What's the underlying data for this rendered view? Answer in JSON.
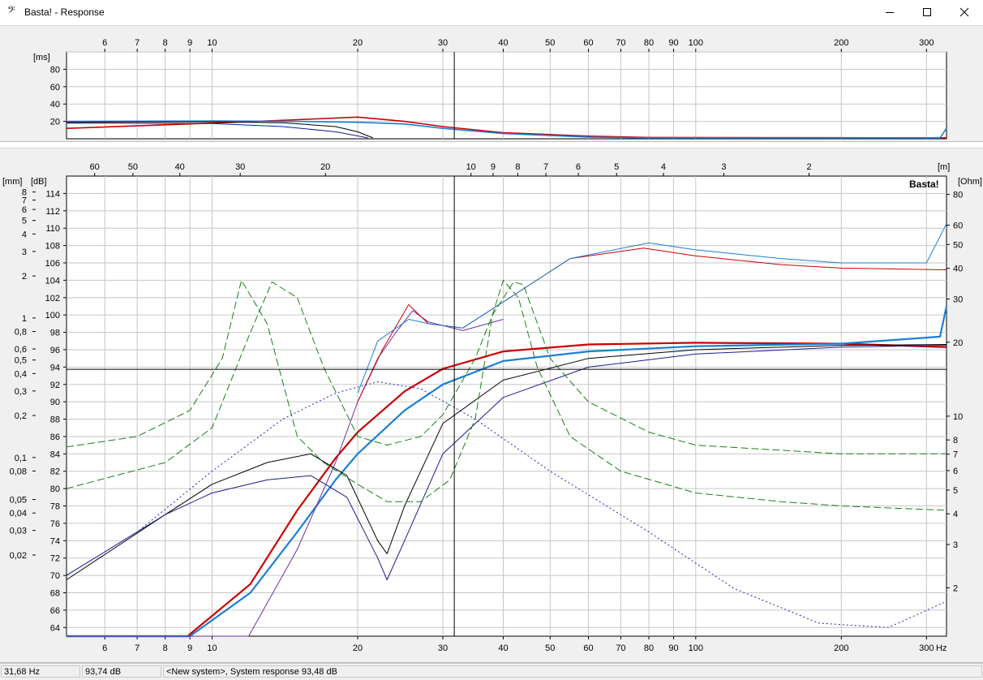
{
  "window": {
    "title": "Basta! - Response",
    "icon": "bass-clef-icon",
    "controls": [
      "minimize-icon",
      "maximize-icon",
      "close-icon"
    ]
  },
  "freq_ticks": [
    "6",
    "7",
    "8",
    "9",
    "10",
    "20",
    "30",
    "40",
    "50",
    "60",
    "70",
    "80",
    "90",
    "100",
    "200",
    "300"
  ],
  "freq_values": [
    6,
    7,
    8,
    9,
    10,
    20,
    30,
    40,
    50,
    60,
    70,
    80,
    90,
    100,
    200,
    300
  ],
  "freq_unit": "Hz",
  "delay_chart": {
    "unit": "[ms]",
    "y_ticks": [
      "80",
      "60",
      "40",
      "20"
    ],
    "y_values": [
      80,
      60,
      40,
      20
    ]
  },
  "main_chart": {
    "wavelength_unit": "[m]",
    "wavelength_ticks": [
      "60",
      "50",
      "40",
      "30",
      "20",
      "10",
      "9",
      "8",
      "7",
      "6",
      "5",
      "4",
      "3",
      "2"
    ],
    "wavelength_values": [
      60,
      50,
      40,
      30,
      20,
      10,
      9,
      8,
      7,
      6,
      5,
      4,
      3,
      2
    ],
    "db_unit": "[dB]",
    "db_ticks": [
      "114",
      "112",
      "110",
      "108",
      "106",
      "104",
      "102",
      "100",
      "98",
      "96",
      "94",
      "92",
      "90",
      "88",
      "86",
      "84",
      "82",
      "80",
      "78",
      "76",
      "74",
      "72",
      "70",
      "68",
      "66",
      "64"
    ],
    "mm_unit": "[mm]",
    "mm_ticks": [
      "8",
      "7",
      "6",
      "5",
      "4",
      "3",
      "2",
      "1",
      "0,8",
      "0,6",
      "0,5",
      "0,4",
      "0,3",
      "0,2",
      "0,1",
      "0,08",
      "0,05",
      "0,04",
      "0,03",
      "0,02"
    ],
    "mm_values": [
      8,
      7,
      6,
      5,
      4,
      3,
      2,
      1,
      0.8,
      0.6,
      0.5,
      0.4,
      0.3,
      0.2,
      0.1,
      0.08,
      0.05,
      0.04,
      0.03,
      0.02
    ],
    "ohm_unit": "[Ohm]",
    "ohm_ticks": [
      "80",
      "60",
      "50",
      "40",
      "30",
      "20",
      "10",
      "8",
      "7",
      "6",
      "5",
      "4",
      "3",
      "2"
    ],
    "ohm_values": [
      80,
      60,
      50,
      40,
      30,
      20,
      10,
      8,
      7,
      6,
      5,
      4,
      3,
      2
    ],
    "watermark": "Basta!"
  },
  "chart_data": {
    "type": "line",
    "x_scale": "log",
    "x_unit": "Hz",
    "xlim": [
      5,
      330
    ],
    "ylim_db": [
      63,
      116
    ],
    "cursor": {
      "frequency_hz": 31.68,
      "level_db": 93.74
    },
    "series": [
      {
        "color": "#cc0000",
        "x": [
          5,
          8.9,
          12,
          15,
          18,
          20,
          25,
          30,
          40,
          60,
          100,
          200,
          330
        ],
        "y": [
          63,
          63,
          69,
          77.5,
          83.5,
          86.5,
          91.2,
          93.8,
          95.8,
          96.6,
          96.8,
          96.7,
          96.3
        ]
      },
      {
        "color": "#1a7fd4",
        "x": [
          5,
          9,
          12,
          15,
          18,
          20,
          25,
          30,
          40,
          60,
          100,
          200,
          320,
          330
        ],
        "y": [
          63,
          63,
          68,
          75,
          81,
          84,
          89,
          92,
          94.7,
          95.8,
          96.4,
          96.7,
          97.5,
          101
        ]
      },
      {
        "color": "#000000",
        "x": [
          5,
          8,
          10,
          13,
          16,
          19,
          22,
          23,
          25,
          30,
          40,
          60,
          100,
          200,
          330
        ],
        "y": [
          69.5,
          77,
          80.5,
          83,
          84,
          81.5,
          74,
          72.5,
          78,
          87.5,
          92.5,
          95,
          96,
          96.5,
          96.6
        ]
      },
      {
        "color": "#1a1a8c",
        "x": [
          5,
          8,
          10,
          13,
          16,
          19,
          22,
          23,
          25,
          30,
          40,
          60,
          100,
          200,
          330
        ],
        "y": [
          70,
          77,
          79.5,
          81,
          81.5,
          79,
          72,
          69.5,
          74,
          84,
          90.5,
          94,
          95.5,
          96.3,
          96.5
        ]
      },
      {
        "color": "#7030a0",
        "x": [
          5,
          11.9,
          15,
          18,
          20,
          22,
          24,
          26,
          28,
          33,
          40
        ],
        "y": [
          63,
          63,
          73,
          83,
          90,
          95,
          98,
          100.5,
          99.2,
          98.2,
          99.5
        ]
      },
      {
        "color": "#cc0000",
        "x": [
          20,
          22.5,
          25.5,
          28,
          33,
          40,
          55,
          78,
          100,
          150,
          200,
          330
        ],
        "y": [
          90,
          96,
          101.2,
          99,
          98.5,
          101.5,
          106.5,
          107.7,
          106.8,
          105.8,
          105.4,
          105.2
        ]
      },
      {
        "color": "#1a7fd4",
        "x": [
          20,
          22,
          25.5,
          28,
          33,
          40,
          55,
          80,
          100,
          150,
          200,
          300,
          330
        ],
        "y": [
          91,
          97,
          99.5,
          99,
          98.5,
          101.5,
          106.5,
          108.3,
          107.5,
          106.5,
          106,
          106,
          110.5
        ]
      },
      {
        "color": "#1a7f1a",
        "x": [
          5,
          7,
          9,
          10.5,
          11.5,
          13,
          15,
          17,
          20,
          23,
          27,
          31,
          35,
          38,
          40,
          43,
          47,
          55,
          70,
          100,
          150,
          200,
          330
        ],
        "y": [
          84.8,
          86,
          89,
          95,
          104,
          99,
          86,
          83,
          80.5,
          78.5,
          78.5,
          81,
          88,
          100,
          104,
          102,
          94,
          86,
          82,
          79.5,
          78.5,
          78,
          77.5
        ]
      },
      {
        "color": "#1a7f1a",
        "x": [
          5,
          8,
          10,
          12,
          13.3,
          15,
          17,
          20,
          23,
          27,
          30,
          35,
          38,
          42,
          44,
          50,
          60,
          80,
          100,
          200,
          330
        ],
        "y": [
          80,
          83,
          87,
          98,
          103.8,
          102,
          94,
          86,
          85,
          86,
          88.5,
          95,
          100,
          103.8,
          103.5,
          95,
          90,
          86.5,
          85,
          84,
          84
        ]
      },
      {
        "color": "#2424b4",
        "x": [
          5,
          7,
          10,
          14,
          18,
          22,
          27,
          35,
          50,
          80,
          120,
          180,
          250,
          330
        ],
        "y": [
          70,
          75,
          82,
          88,
          91,
          92.3,
          91.5,
          88,
          82,
          75,
          68.5,
          64.5,
          64,
          67
        ]
      }
    ]
  },
  "delay_data": {
    "type": "line",
    "x_scale": "log",
    "ylim_ms": [
      0,
      100
    ],
    "series": [
      {
        "color": "#cc0000",
        "x": [
          5,
          10,
          15,
          20,
          25,
          30,
          40,
          60,
          80,
          330
        ],
        "y": [
          12,
          18,
          22,
          25,
          20,
          14,
          7,
          3,
          1.5,
          1
        ]
      },
      {
        "color": "#1a7fd4",
        "x": [
          5,
          10,
          15,
          20,
          25,
          30,
          40,
          60,
          80,
          320,
          330
        ],
        "y": [
          20,
          20.5,
          20,
          19,
          17,
          12,
          6,
          2,
          1,
          1,
          12
        ]
      },
      {
        "color": "#000000",
        "x": [
          5,
          10,
          14,
          18,
          20,
          21.5
        ],
        "y": [
          19,
          19.5,
          18.5,
          14,
          8,
          1
        ]
      },
      {
        "color": "#1a1a8c",
        "x": [
          5,
          10,
          14,
          18,
          21
        ],
        "y": [
          18,
          17.5,
          14,
          8,
          1
        ]
      }
    ]
  },
  "status": {
    "frequency": "31,68 Hz",
    "level": "93,74 dB",
    "message": "<New system>, System response 93,48 dB"
  }
}
